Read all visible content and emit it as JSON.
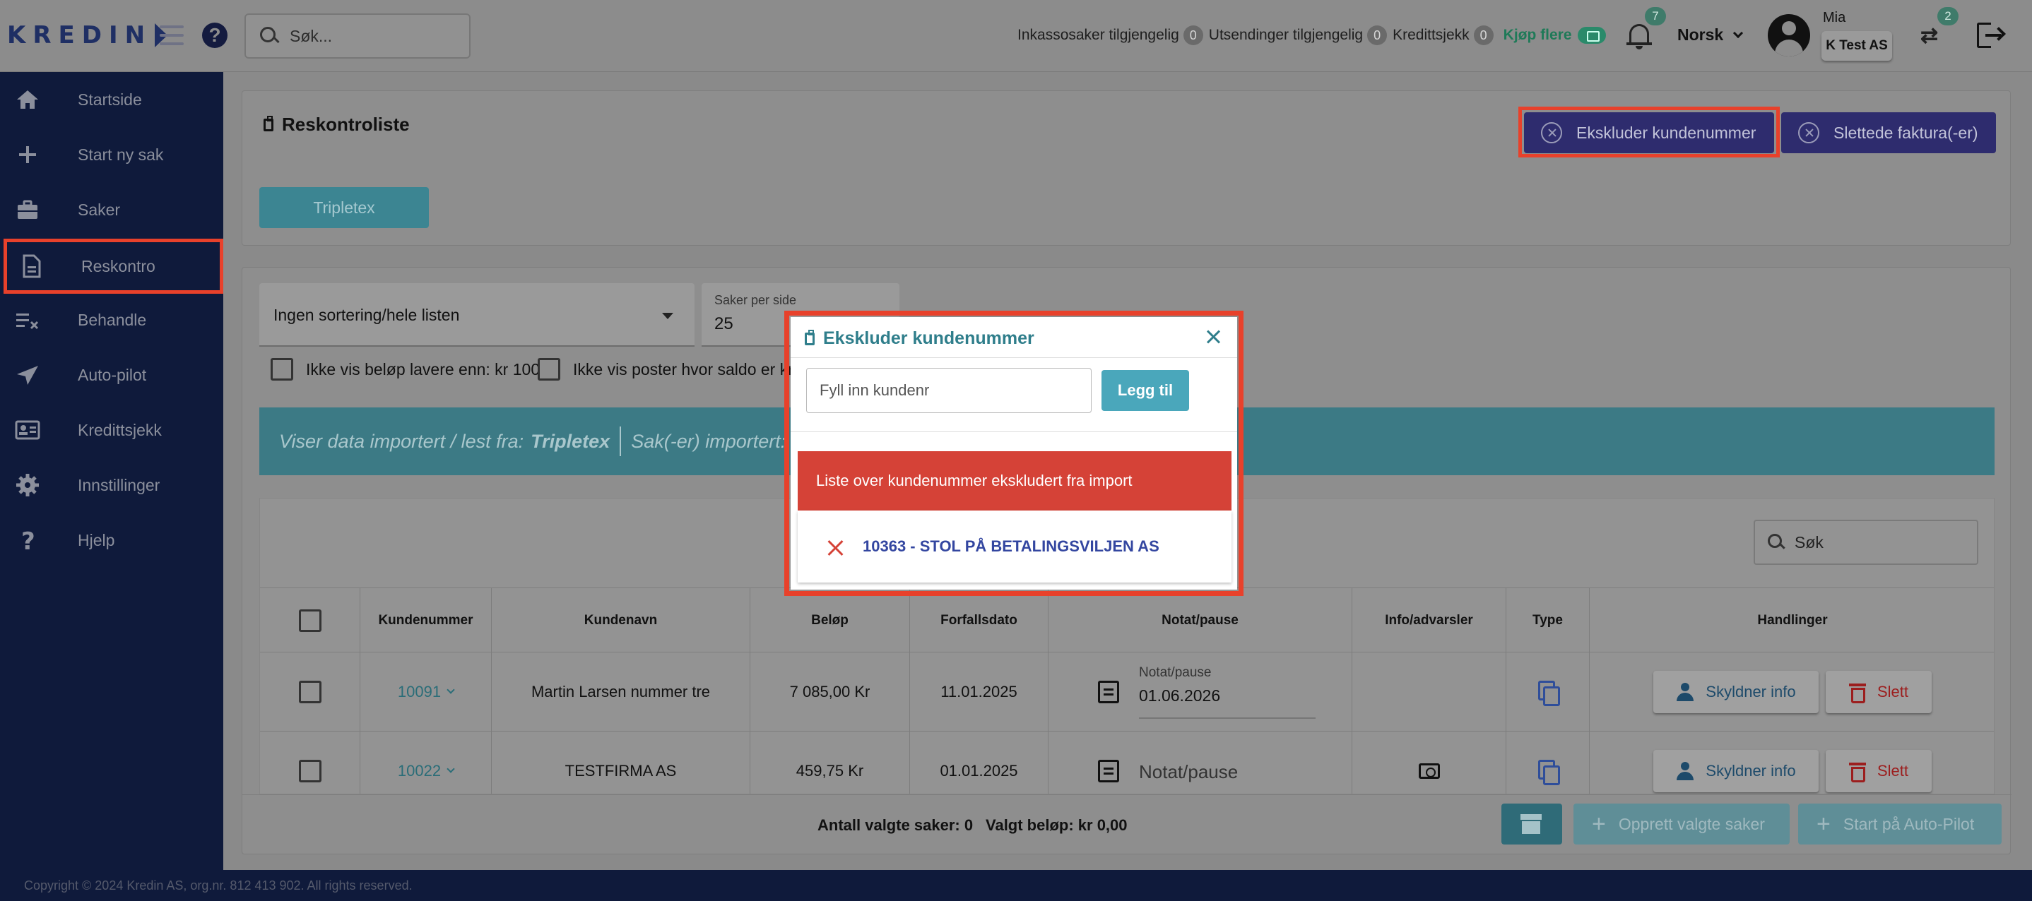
{
  "header": {
    "logo_text": "KREDIN",
    "search_placeholder": "Søk...",
    "counters": [
      {
        "label": "Inkassosaker tilgjengelig",
        "value": "0"
      },
      {
        "label": "Utsendinger tilgjengelig",
        "value": "0"
      },
      {
        "label": "Kredittsjekk",
        "value": "0"
      }
    ],
    "buy_more": "Kjøp flere",
    "notifications_count": "7",
    "language": "Norsk",
    "user_name": "Mia",
    "company": "K Test AS",
    "switch_count": "2"
  },
  "sidebar": {
    "items": [
      {
        "label": "Startside",
        "icon": "home-icon"
      },
      {
        "label": "Start ny sak",
        "icon": "plus-icon"
      },
      {
        "label": "Saker",
        "icon": "briefcase-icon"
      },
      {
        "label": "Reskontro",
        "icon": "document-icon"
      },
      {
        "label": "Behandle",
        "icon": "checklist-icon"
      },
      {
        "label": "Auto-pilot",
        "icon": "airplane-icon"
      },
      {
        "label": "Kredittsjekk",
        "icon": "id-card-icon"
      },
      {
        "label": "Innstillinger",
        "icon": "gear-icon"
      },
      {
        "label": "Hjelp",
        "icon": "question-icon"
      }
    ],
    "active": "Reskontro"
  },
  "page": {
    "title": "Reskontroliste",
    "exclude_button": "Ekskluder kundenummer",
    "deleted_button": "Slettede faktura(-er)",
    "source_button": "Tripletex",
    "sort_value": "Ingen sortering/hele listen",
    "per_page_label": "Saker per side",
    "per_page_value": "25",
    "filter1": "Ikke vis beløp lavere enn: kr 100",
    "filter2": "Ikke vis poster hvor saldo er kr",
    "banner_prefix": "Viser data importert / lest fra:",
    "banner_source": "Tripletex",
    "banner_imported": "Sak(-er) importert:",
    "table_search": "Søk"
  },
  "table": {
    "columns": [
      "Kundenummer",
      "Kundenavn",
      "Beløp",
      "Forfallsdato",
      "Notat/pause",
      "Info/advarsler",
      "Type",
      "Handlinger"
    ],
    "rows": [
      {
        "kundenummer": "10091",
        "kundenavn": "Martin Larsen nummer tre",
        "belop": "7 085,00 Kr",
        "forfall": "11.01.2025",
        "notat_label": "Notat/pause",
        "notat_value": "01.06.2026",
        "info": ""
      },
      {
        "kundenummer": "10022",
        "kundenavn": "TESTFIRMA AS",
        "belop": "459,75 Kr",
        "forfall": "01.01.2025",
        "notat_label": "",
        "notat_value": "Notat/pause",
        "info": "money-icon"
      }
    ],
    "info_button": "Skyldner info",
    "delete_button": "Slett"
  },
  "footer": {
    "selected_count": "Antall valgte saker: 0",
    "selected_amount": "Valgt beløp: kr 0,00",
    "create_button": "Opprett valgte saker",
    "autopilot_button": "Start på Auto-Pilot",
    "copyright": "Copyright © 2024 Kredin AS, org.nr. 812 413 902. All rights reserved."
  },
  "modal": {
    "title": "Ekskluder kundenummer",
    "input_placeholder": "Fyll inn kundenr",
    "add_button": "Legg til",
    "list_title": "Liste over kundenummer ekskludert fra import",
    "excluded": [
      "10363 - STOL PÅ BETALINGSVILJEN AS"
    ]
  },
  "colors": {
    "sidebar_bg": "#0f1a3b",
    "highlight": "#e8412b",
    "accent_teal": "#4aa7bb",
    "navy_button": "#2e2c6e",
    "list_header_red": "#d54237"
  }
}
